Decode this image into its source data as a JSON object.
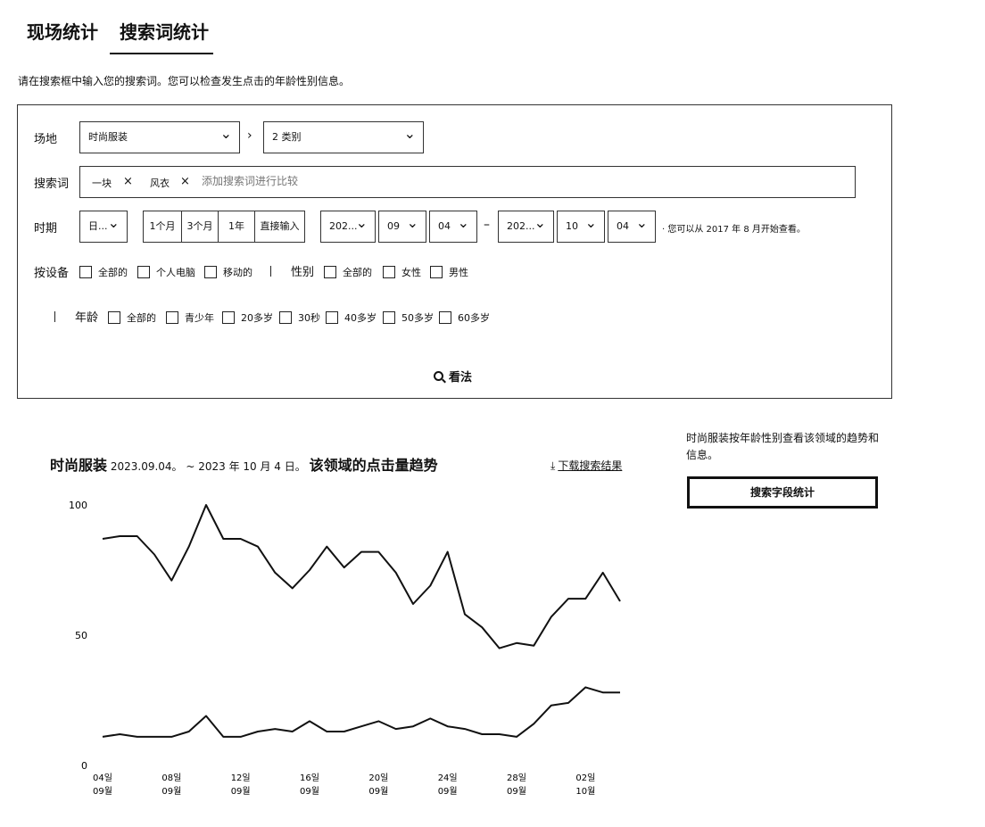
{
  "tabs": [
    {
      "label": "现场统计",
      "active": false
    },
    {
      "label": "搜索词统计",
      "active": true
    }
  ],
  "notice": "请在搜索框中输入您的搜索词。您可以检查发生点击的年龄性别信息。",
  "filters": {
    "venue_label": "场地",
    "venue_select": "时尚服装",
    "category_select": "2 类别",
    "keyword_label": "搜索词",
    "keywords": [
      "一块",
      "风衣"
    ],
    "keyword_add_placeholder": "添加搜索词进行比较",
    "period_label": "时期",
    "period_unit": "日...",
    "period_buttons": [
      "1个月",
      "3个月",
      "1年",
      "直接输入"
    ],
    "start_year": "202...",
    "start_month": "09",
    "start_day": "04",
    "end_year": "202...",
    "end_month": "10",
    "end_day": "04",
    "date_note": "· 您可以从 2017 年 8 月开始查看。",
    "device_label": "按设备",
    "device_options": [
      "全部的",
      "个人电脑",
      "移动的"
    ],
    "gender_label": "性别",
    "gender_options": [
      "全部的",
      "女性",
      "男性"
    ],
    "age_label": "年龄",
    "age_options": [
      "全部的",
      "青少年",
      "20多岁",
      "30秒",
      "40多岁",
      "50多岁",
      "60多岁"
    ],
    "view_button": "看法"
  },
  "chart_header": {
    "category": "时尚服装",
    "date_range": "2023.09.04。 ~ 2023 年 10 月 4 日。",
    "title_suffix": "该领域的点击量趋势",
    "download_label": "下载搜索结果"
  },
  "side_panel": {
    "text": "时尚服装按年龄性别查看该领域的趋势和信息。",
    "button_label": "搜索字段统计"
  },
  "colors": {
    "line": "#111111",
    "border": "#333333"
  },
  "chart_data": {
    "type": "line",
    "x": [
      "09-04",
      "09-05",
      "09-06",
      "09-07",
      "09-08",
      "09-09",
      "09-10",
      "09-11",
      "09-12",
      "09-13",
      "09-14",
      "09-15",
      "09-16",
      "09-17",
      "09-18",
      "09-19",
      "09-20",
      "09-21",
      "09-22",
      "09-23",
      "09-24",
      "09-25",
      "09-26",
      "09-27",
      "09-28",
      "09-29",
      "09-30",
      "10-01",
      "10-02",
      "10-03",
      "10-04"
    ],
    "x_tick_labels": [
      {
        "day": "04일",
        "month": "09월"
      },
      {
        "day": "08일",
        "month": "09월"
      },
      {
        "day": "12일",
        "month": "09월"
      },
      {
        "day": "16일",
        "month": "09월"
      },
      {
        "day": "20일",
        "month": "09월"
      },
      {
        "day": "24일",
        "month": "09월"
      },
      {
        "day": "28일",
        "month": "09월"
      },
      {
        "day": "02일",
        "month": "10월"
      }
    ],
    "series": [
      {
        "name": "一块",
        "values": [
          87,
          88,
          88,
          81,
          71,
          84,
          100,
          87,
          87,
          84,
          74,
          68,
          75,
          84,
          76,
          82,
          82,
          74,
          62,
          69,
          82,
          58,
          53,
          45,
          47,
          46,
          57,
          64,
          64,
          74,
          63
        ]
      },
      {
        "name": "风衣",
        "values": [
          11,
          12,
          11,
          11,
          11,
          13,
          19,
          11,
          11,
          13,
          14,
          13,
          17,
          13,
          13,
          15,
          17,
          14,
          15,
          18,
          15,
          14,
          12,
          12,
          11,
          16,
          23,
          24,
          30,
          28,
          28
        ]
      }
    ],
    "y_ticks": [
      0,
      50,
      100
    ],
    "ylim": [
      0,
      100
    ],
    "grid": false,
    "legend": "none"
  }
}
